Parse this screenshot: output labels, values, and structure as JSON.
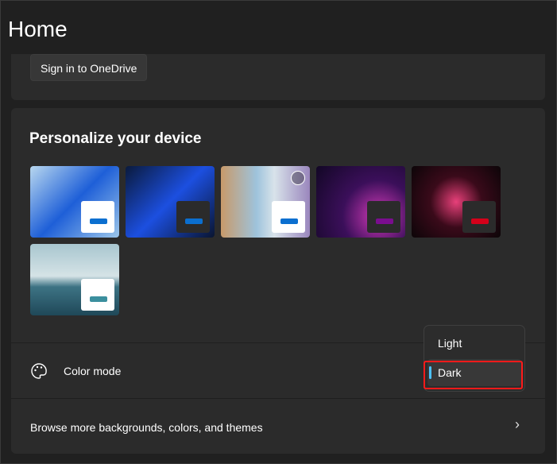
{
  "header": {
    "title": "Home"
  },
  "onedrive": {
    "button": "Sign in to OneDrive"
  },
  "personalize": {
    "title": "Personalize your device",
    "themes": [
      {
        "name": "windows-light",
        "bg": "linear-gradient(135deg,#b8d7ef,#1e5fd8 50%,#9cc6ea)",
        "swatch": "#ffffff",
        "bar": "#0b6fd0"
      },
      {
        "name": "windows-dark",
        "bg": "linear-gradient(135deg,#0a1a3c,#1c4fe0 50%,#0a1530)",
        "swatch": "#2b2b2b",
        "bar": "#0b6fd0"
      },
      {
        "name": "glow-flowers",
        "bg": "linear-gradient(90deg,#c89a6a,#9ec3dc 40%,#d8e3ea 60%,#9a86bd)",
        "swatch": "#ffffff",
        "bar": "#0b6fd0"
      },
      {
        "name": "captured-motion",
        "bg": "radial-gradient(circle at 70% 70%,#d23ab8,#3b0f5a 45%,#120725)",
        "swatch": "#2b2b2b",
        "bar": "#7a0d8f"
      },
      {
        "name": "flow",
        "bg": "radial-gradient(circle at 50% 50%,#e8407a,#3a0a1a 45%,#0c0508)",
        "swatch": "#2b2b2b",
        "bar": "#d4001a"
      },
      {
        "name": "sunrise-lake",
        "bg": "linear-gradient(180deg,#a8c6cf,#d5e3e6 45%,#3d7384 60%,#1f4858)",
        "swatch": "#ffffff",
        "bar": "#3b8f9e"
      }
    ]
  },
  "color_mode": {
    "label": "Color mode",
    "options": [
      "Light",
      "Dark"
    ],
    "selected": "Dark"
  },
  "browse": {
    "label": "Browse more backgrounds, colors, and themes"
  },
  "colors": {
    "accent": "#4cc2ff",
    "highlight": "#ff1a1a"
  }
}
